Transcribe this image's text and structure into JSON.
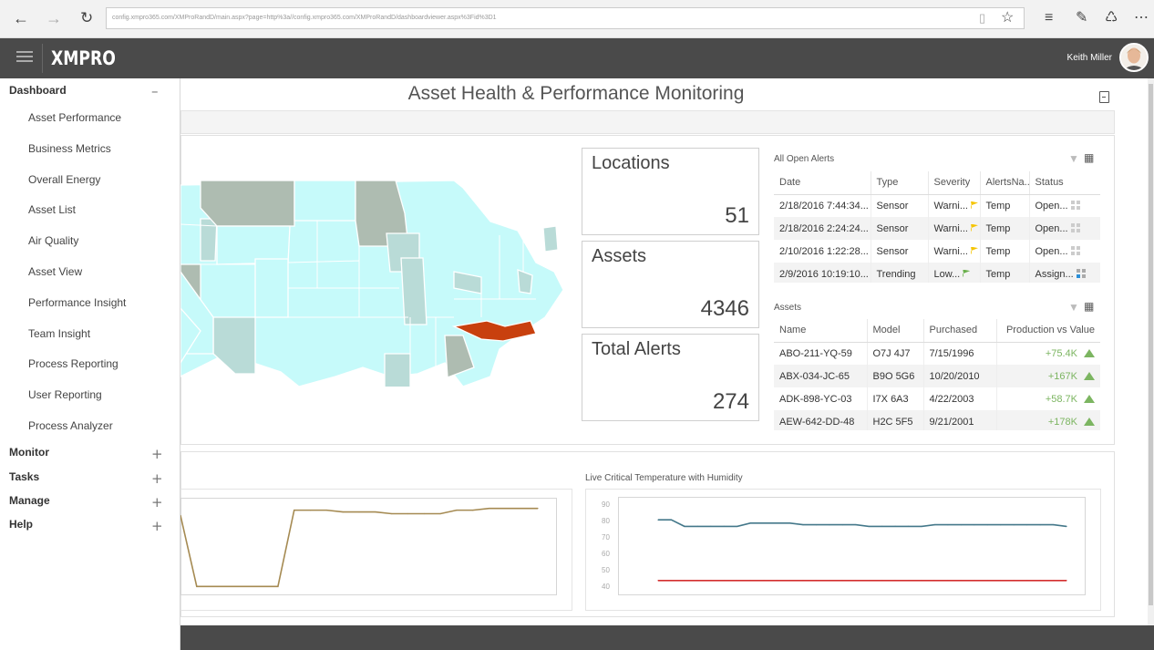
{
  "browser": {
    "url": "config.xmpro365.com/XMProRandD/main.aspx?page=http%3a//config.xmpro365.com/XMProRandD/dashboardviewer.aspx%3Fid%3D1"
  },
  "header": {
    "logo": "XMPRO",
    "user_name": "Keith Miller"
  },
  "sidebar": {
    "sections": [
      {
        "label": "Dashboard",
        "control": "–"
      },
      {
        "label": "Monitor",
        "control": "+"
      },
      {
        "label": "Tasks",
        "control": "+"
      },
      {
        "label": "Manage",
        "control": "+"
      },
      {
        "label": "Help",
        "control": "+"
      }
    ],
    "dashboard_items": [
      {
        "label": "Asset Performance"
      },
      {
        "label": "Business Metrics"
      },
      {
        "label": "Overall Energy"
      },
      {
        "label": "Asset List"
      },
      {
        "label": "Air Quality"
      },
      {
        "label": "Asset View"
      },
      {
        "label": "Performance Insight"
      },
      {
        "label": "Team Insight"
      },
      {
        "label": "Process Reporting"
      },
      {
        "label": "User Reporting"
      },
      {
        "label": "Process Analyzer"
      }
    ]
  },
  "main": {
    "title": "Asset Health & Performance Monitoring",
    "cards": [
      {
        "label": "Locations",
        "value": "51"
      },
      {
        "label": "Assets",
        "value": "4346"
      },
      {
        "label": "Total Alerts",
        "value": "274"
      }
    ],
    "alerts_grid": {
      "title": "All Open Alerts",
      "columns": [
        "Date",
        "Type",
        "Severity",
        "AlertsNa...",
        "Status"
      ],
      "rows": [
        {
          "date": "2/18/2016 7:44:34...",
          "type": "Sensor",
          "severity": "Warni...",
          "flag_color": "#f5c400",
          "name": "Temp",
          "status": "Open...",
          "status_icon": "grey"
        },
        {
          "date": "2/18/2016 2:24:24...",
          "type": "Sensor",
          "severity": "Warni...",
          "flag_color": "#f5c400",
          "name": "Temp",
          "status": "Open...",
          "status_icon": "grey"
        },
        {
          "date": "2/10/2016 1:22:28...",
          "type": "Sensor",
          "severity": "Warni...",
          "flag_color": "#f5c400",
          "name": "Temp",
          "status": "Open...",
          "status_icon": "grey"
        },
        {
          "date": "2/9/2016 10:19:10...",
          "type": "Trending",
          "severity": "Low...",
          "flag_color": "#6ab04c",
          "name": "Temp",
          "status": "Assign...",
          "status_icon": "blue"
        }
      ]
    },
    "assets_grid": {
      "title": "Assets",
      "columns": [
        "Name",
        "Model",
        "Purchased",
        "Production vs Value"
      ],
      "rows": [
        {
          "name": "ABO-211-YQ-59",
          "model": "O7J 4J7",
          "purchased": "7/15/1996",
          "production": "+75.4K"
        },
        {
          "name": "ABX-034-JC-65",
          "model": "B9O 5G6",
          "purchased": "10/20/2010",
          "production": "+167K"
        },
        {
          "name": "ADK-898-YC-03",
          "model": "I7X 6A3",
          "purchased": "4/22/2003",
          "production": "+58.7K"
        },
        {
          "name": "AEW-642-DD-48",
          "model": "H2C 5F5",
          "purchased": "9/21/2001",
          "production": "+178K"
        }
      ]
    },
    "colors": {
      "map_highlight": "#c8400e",
      "map_base": "#c6fafa",
      "map_mid": "#b9dbd7",
      "map_dark": "#aebcb1",
      "line_brown": "#a58a52",
      "line_teal": "#44788a",
      "line_red": "#d32f2f",
      "positive": "#7cb561",
      "header_bg": "#4a4a4a"
    }
  },
  "chart_data": [
    {
      "type": "line",
      "title": "",
      "series": [
        {
          "values": [
            80,
            40,
            40,
            40,
            40,
            40,
            40,
            83,
            83,
            83,
            82,
            82,
            82,
            81,
            81,
            81,
            81,
            83,
            83,
            84,
            84,
            84,
            84
          ]
        }
      ],
      "grid": false
    },
    {
      "type": "line",
      "title": "Live Critical Temperature with Humidity",
      "ylim": [
        40,
        90
      ],
      "yticks": [
        "90",
        "80",
        "70",
        "60",
        "50",
        "40"
      ],
      "series": [
        {
          "color": "#44788a",
          "values": [
            81,
            81,
            77,
            77,
            77,
            77,
            77,
            79,
            79,
            79,
            79,
            78,
            78,
            78,
            78,
            78,
            77,
            77,
            77,
            77,
            77,
            78,
            78,
            78,
            78,
            78,
            78,
            78,
            78,
            78,
            78,
            77
          ]
        },
        {
          "color": "#d32f2f",
          "values": [
            44,
            44,
            44,
            44,
            44,
            44,
            44,
            44,
            44,
            44,
            44,
            44,
            44,
            44,
            44,
            44,
            44,
            44,
            44,
            44,
            44,
            44,
            44,
            44,
            44,
            44,
            44,
            44,
            44,
            44,
            44,
            44
          ]
        }
      ],
      "grid": false
    }
  ]
}
